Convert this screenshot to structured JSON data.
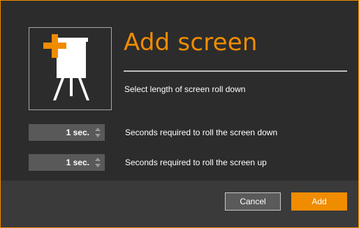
{
  "dialog": {
    "title": "Add screen",
    "subtitle": "Select length of screen roll down",
    "icon": "projector-screen-add-icon",
    "accent_color": "#f08c00"
  },
  "settings": [
    {
      "value": "1 sec.",
      "label": "Seconds required to roll the screen down"
    },
    {
      "value": "1 sec.",
      "label": "Seconds required to roll the screen up"
    }
  ],
  "buttons": {
    "cancel_label": "Cancel",
    "add_label": "Add"
  }
}
